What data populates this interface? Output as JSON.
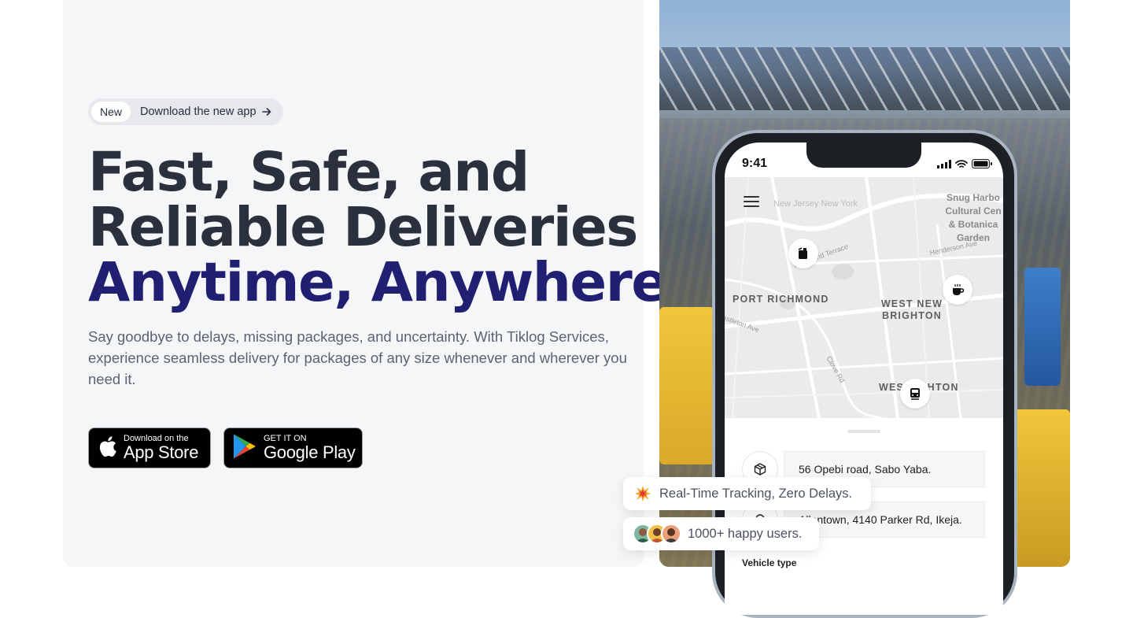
{
  "hero": {
    "badge_tag": "New",
    "badge_text": "Download the new app",
    "headline_line1": "Fast, Safe, and",
    "headline_line2": "Reliable Deliveries",
    "headline_accent": "Anytime, Anywhere.",
    "subtitle": "Say goodbye to delays, missing packages, and uncertainty. With Tiklog Services, experience seamless delivery for packages of any size whenever and wherever you need it.",
    "app_store_small": "Download on the",
    "app_store_big": "App Store",
    "google_play_small": "GET IT ON",
    "google_play_big": "Google Play"
  },
  "phone": {
    "status_time": "9:41",
    "map_labels": {
      "port_richmond": "PORT RICHMOND",
      "west_new_brighton": "WEST NEW BRIGHTON",
      "west_brighton": "WES   IGHTON",
      "new_jersey": "New Jersey New York",
      "snug_harbor": "Snug Harbo Cultural Cen & Botanica Garden",
      "richmond_terrace": "Richmond Terrace",
      "henderson": "Henderson Ave",
      "castleton": "astleton Ave",
      "clove": "Clove Rd"
    },
    "pickup_address": "56 Opebi road, Sabo Yaba.",
    "dropoff_address": "Allentown, 4140 Parker Rd, Ikeja.",
    "vehicle_type_label": "Vehicle type"
  },
  "toasts": {
    "tracking": "Real-Time Tracking, Zero Delays.",
    "users": "1000+ happy users."
  },
  "colors": {
    "accent": "#211f72",
    "headline": "#2a313d",
    "panel_bg": "#f5f6f8"
  }
}
